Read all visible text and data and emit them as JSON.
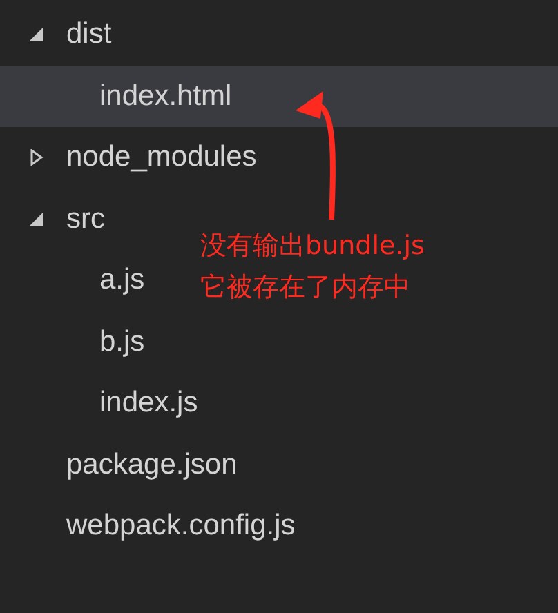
{
  "tree": [
    {
      "kind": "folder",
      "label": "dist",
      "expanded": true,
      "selected": false,
      "children": [
        {
          "kind": "file",
          "label": "index.html",
          "selected": true
        }
      ]
    },
    {
      "kind": "folder",
      "label": "node_modules",
      "expanded": false,
      "selected": false
    },
    {
      "kind": "folder",
      "label": "src",
      "expanded": true,
      "selected": false,
      "children": [
        {
          "kind": "file",
          "label": "a.js",
          "selected": false
        },
        {
          "kind": "file",
          "label": "b.js",
          "selected": false
        },
        {
          "kind": "file",
          "label": "index.js",
          "selected": false
        }
      ]
    },
    {
      "kind": "file",
      "label": "package.json",
      "selected": false
    },
    {
      "kind": "file",
      "label": "webpack.config.js",
      "selected": false
    }
  ],
  "annotation": {
    "lines": [
      "没有输出bundle.js",
      "它被存在了内存中"
    ],
    "color": "#ff2a1f"
  }
}
